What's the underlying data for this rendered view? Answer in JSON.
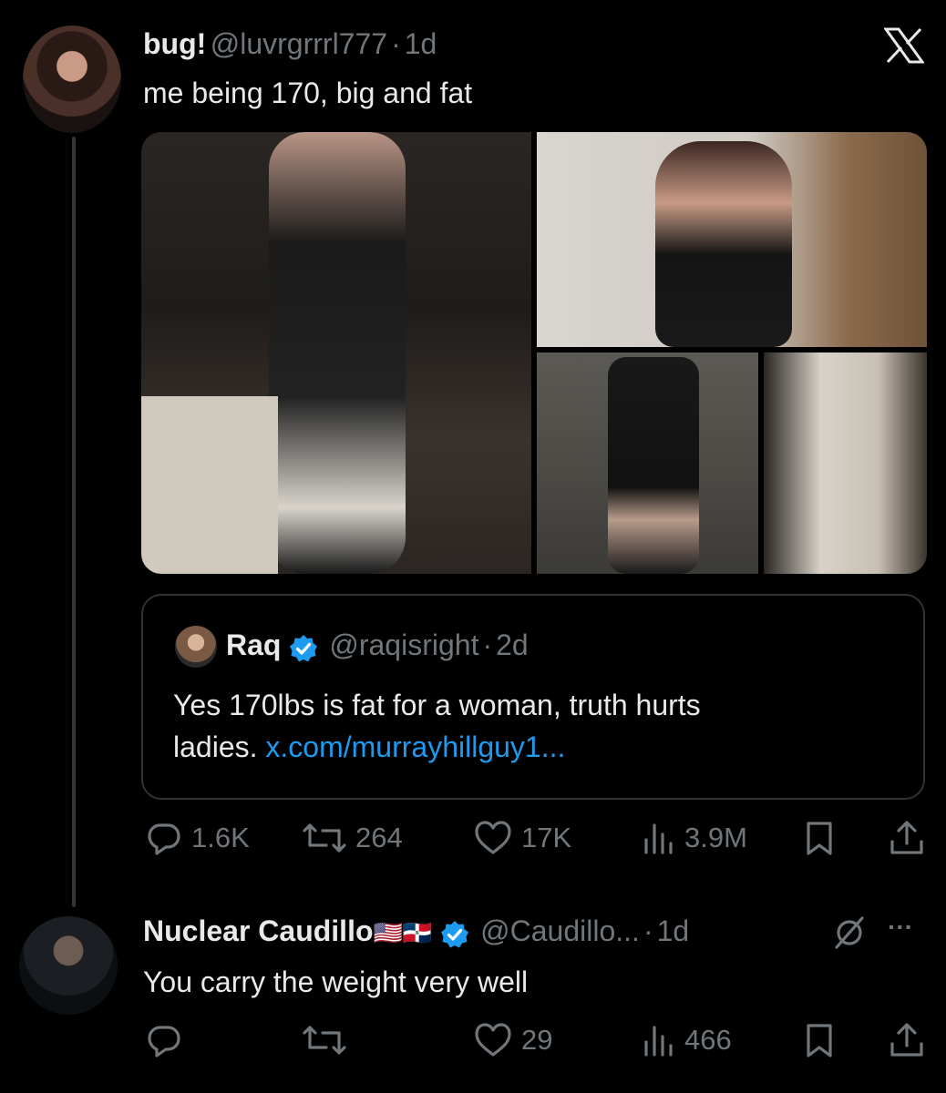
{
  "close_label": "X",
  "post": {
    "name": "bug!",
    "handle": "@luvrgrrrl777",
    "time": "1d",
    "separator": "·",
    "text": "me being 170, big and fat",
    "quote": {
      "name": "Raq",
      "handle": "@raqisright",
      "time": "2d",
      "text_line1": "Yes 170lbs is fat for a woman, truth hurts",
      "text_line2_prefix": "ladies. ",
      "link": "x.com/murrayhillguy1..."
    },
    "stats": {
      "replies": "1.6K",
      "reposts": "264",
      "likes": "17K",
      "views": "3.9M"
    }
  },
  "reply": {
    "name": "Nuclear Caudillo",
    "flags": "🇺🇸🇩🇴",
    "handle": "@Caudillo...",
    "time": "1d",
    "separator": "·",
    "text": "You carry the weight very well",
    "stats": {
      "replies": "",
      "reposts": "",
      "likes": "29",
      "views": "466"
    },
    "more_label": "···"
  },
  "colors": {
    "background": "#000000",
    "text": "#e7e9ea",
    "muted": "#71767b",
    "link": "#1d9bf0",
    "verified": "#1d9bf0"
  },
  "icons": [
    "x-logo-icon",
    "reply-icon",
    "repost-icon",
    "like-icon",
    "views-icon",
    "bookmark-icon",
    "share-icon",
    "verified-badge-icon",
    "grok-icon",
    "more-icon"
  ]
}
